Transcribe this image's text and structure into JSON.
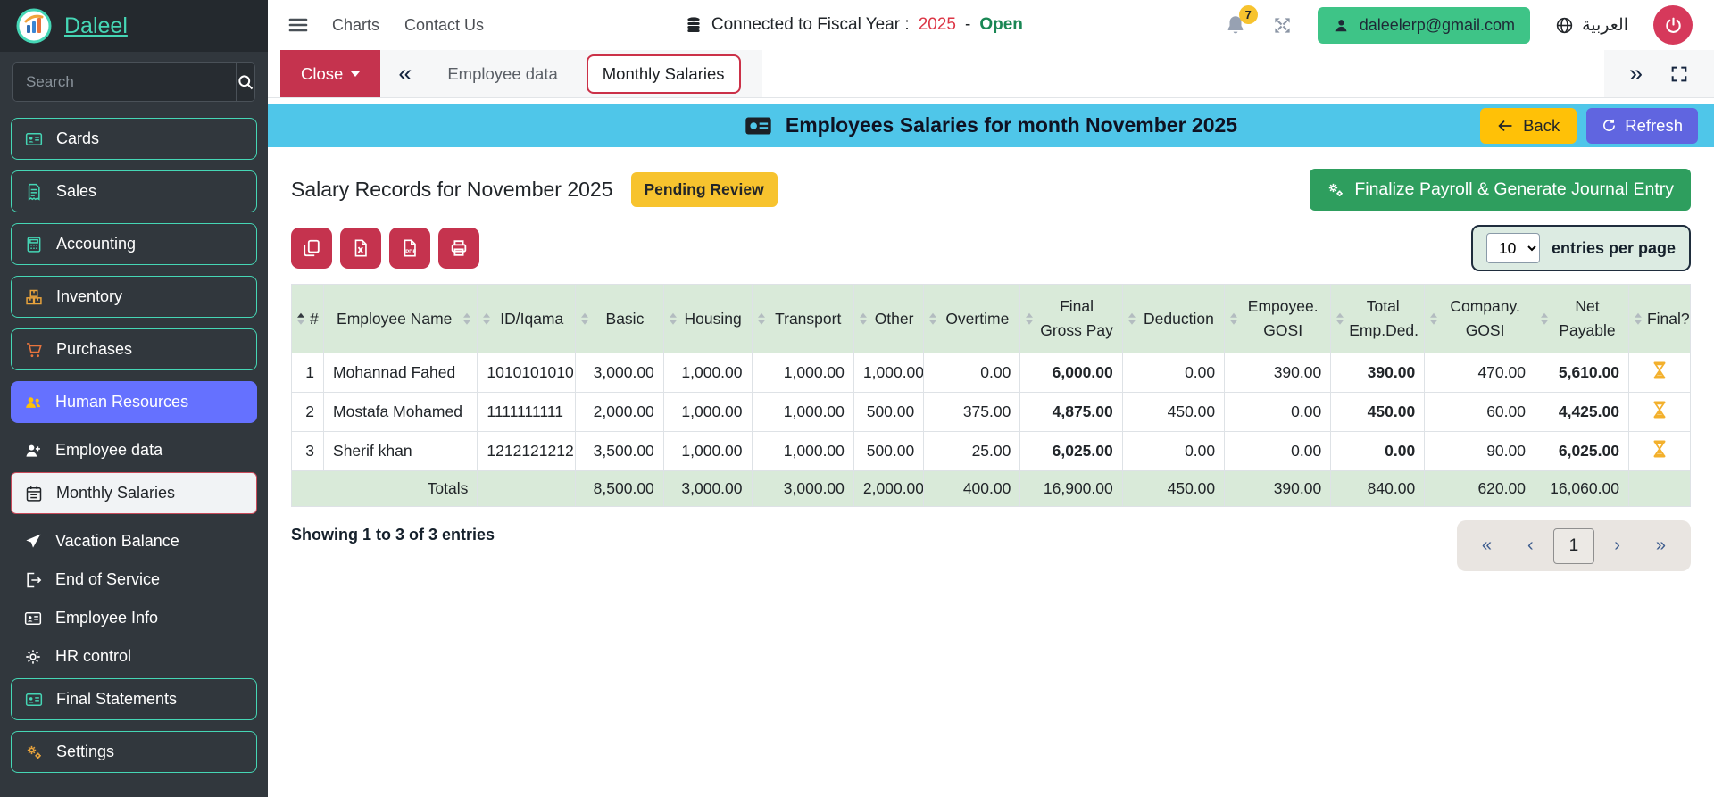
{
  "brand": {
    "name": "Daleel"
  },
  "sidebar": {
    "search_placeholder": "Search",
    "items": [
      {
        "label": "Cards",
        "icon": "id-card-icon",
        "variant": "boxed",
        "icon_color": "#45d6b5"
      },
      {
        "label": "Sales",
        "icon": "invoice-icon",
        "variant": "boxed",
        "icon_color": "#45d6b5"
      },
      {
        "label": "Accounting",
        "icon": "calculator-icon",
        "variant": "boxed",
        "icon_color": "#45d6b5"
      },
      {
        "label": "Inventory",
        "icon": "boxes-icon",
        "variant": "boxed",
        "icon_color": "#e8a33d"
      },
      {
        "label": "Purchases",
        "icon": "cart-icon",
        "variant": "boxed",
        "icon_color": "#e8743d"
      },
      {
        "label": "Human Resources",
        "icon": "users-icon",
        "variant": "highlight",
        "icon_color": "#ffc107"
      },
      {
        "label": "Employee data",
        "icon": "user-plus-icon",
        "variant": "plain",
        "icon_color": "#ffffff"
      },
      {
        "label": "Monthly Salaries",
        "icon": "calendar-icon",
        "variant": "active",
        "icon_color": "#212529"
      },
      {
        "label": "Vacation Balance",
        "icon": "plane-icon",
        "variant": "plain",
        "icon_color": "#ffffff"
      },
      {
        "label": "End of Service",
        "icon": "door-open-icon",
        "variant": "plain",
        "icon_color": "#ffffff"
      },
      {
        "label": "Employee Info",
        "icon": "id-card-icon",
        "variant": "plain",
        "icon_color": "#ffffff"
      },
      {
        "label": "HR control",
        "icon": "gear-icon",
        "variant": "plain",
        "icon_color": "#ffffff"
      },
      {
        "label": "Final Statements",
        "icon": "id-card-icon",
        "variant": "boxed",
        "icon_color": "#45d6b5"
      },
      {
        "label": "Settings",
        "icon": "gears-icon",
        "variant": "boxed",
        "icon_color": "#e8a33d"
      }
    ]
  },
  "topbar": {
    "nav": [
      "Charts",
      "Contact Us"
    ],
    "fiscal": {
      "prefix": "Connected to Fiscal Year :",
      "year": "2025",
      "dash": "-",
      "status": "Open"
    },
    "notification_count": "7",
    "email": "daleelerp@gmail.com",
    "language": "العربية"
  },
  "tabbar": {
    "close_label": "Close",
    "history_back": "«",
    "history_forward": "»",
    "tabs": [
      {
        "label": "Employee data",
        "active": false
      },
      {
        "label": "Monthly Salaries",
        "active": true
      }
    ]
  },
  "page": {
    "title": "Employees Salaries for month November 2025",
    "back_label": "Back",
    "refresh_label": "Refresh",
    "section_title": "Salary Records for November 2025",
    "status_badge": "Pending Review",
    "finalize_label": "Finalize Payroll & Generate Journal Entry",
    "entries_select_value": "10",
    "entries_label": "entries per page",
    "export_buttons": [
      "copy",
      "excel",
      "pdf",
      "print"
    ],
    "showing_text": "Showing 1 to 3 of 3 entries",
    "pagination": {
      "first": "«",
      "prev": "‹",
      "current": "1",
      "next": "›",
      "last": "»"
    }
  },
  "table": {
    "columns": [
      "#",
      "Employee Name",
      "ID/Iqama",
      "Basic",
      "Housing",
      "Transport",
      "Other",
      "Overtime",
      "Final Gross Pay",
      "Deduction",
      "Empoyee. GOSI",
      "Total Emp.Ded.",
      "Company. GOSI",
      "Net Payable",
      "Final?"
    ],
    "rows": [
      [
        "1",
        "Mohannad Fahed",
        "1010101010",
        "3,000.00",
        "1,000.00",
        "1,000.00",
        "1,000.00",
        "0.00",
        "6,000.00",
        "0.00",
        "390.00",
        "390.00",
        "470.00",
        "5,610.00"
      ],
      [
        "2",
        "Mostafa Mohamed",
        "1111111111",
        "2,000.00",
        "1,000.00",
        "1,000.00",
        "500.00",
        "375.00",
        "4,875.00",
        "450.00",
        "0.00",
        "450.00",
        "60.00",
        "4,425.00"
      ],
      [
        "3",
        "Sherif khan",
        "1212121212",
        "3,500.00",
        "1,000.00",
        "1,000.00",
        "500.00",
        "25.00",
        "6,025.00",
        "0.00",
        "0.00",
        "0.00",
        "90.00",
        "6,025.00"
      ]
    ],
    "totals_label": "Totals",
    "totals": [
      "8,500.00",
      "3,000.00",
      "3,000.00",
      "2,000.00",
      "400.00",
      "16,900.00",
      "450.00",
      "390.00",
      "840.00",
      "620.00",
      "16,060.00"
    ]
  },
  "colors": {
    "brand_teal": "#45d6b5",
    "header_cyan": "#4fc6e9",
    "danger_red": "#c5334e",
    "warning_yellow": "#f7c32e",
    "success_green": "#2e9e5e",
    "refresh_blue": "#6065e0",
    "hr_highlight_blue": "#6571ff",
    "table_header_green": "#d9ead9",
    "hourglass_amber": "#f3b02c"
  }
}
